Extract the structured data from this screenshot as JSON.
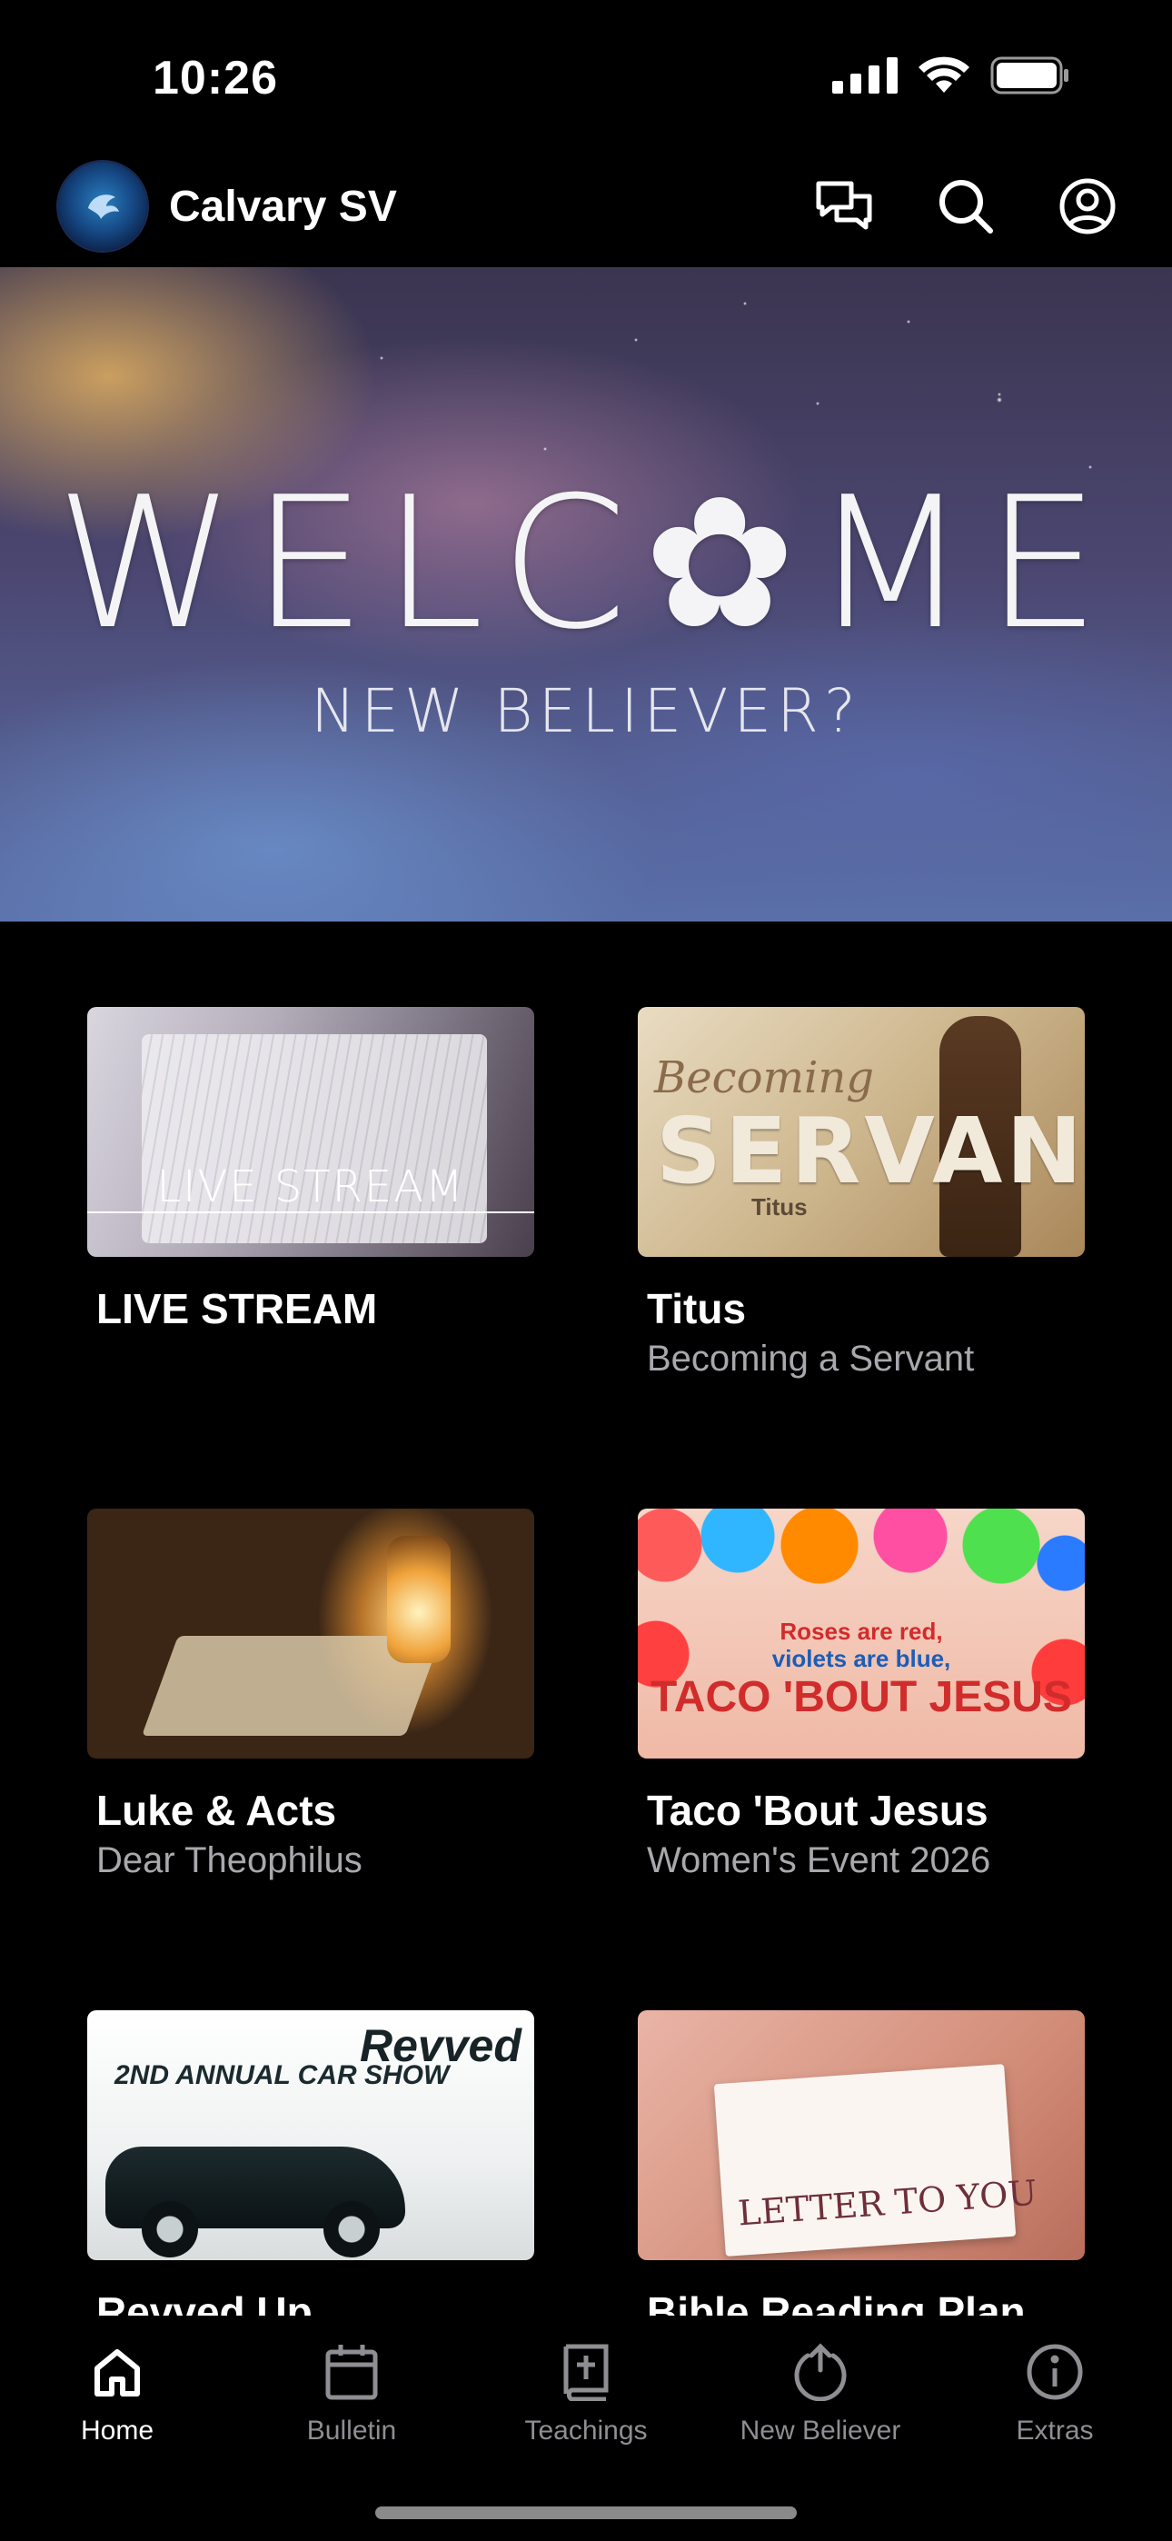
{
  "status_bar": {
    "time": "10:26"
  },
  "header": {
    "app_title": "Calvary SV",
    "actions": [
      "chat-icon",
      "search-icon",
      "account-icon"
    ]
  },
  "hero": {
    "title": "WELC✿ME",
    "subtitle": "NEW BELIEVER?"
  },
  "cards": [
    {
      "title": "LIVE STREAM",
      "subtitle": "",
      "thumb_text": "LIVE STREAM"
    },
    {
      "title": "Titus",
      "subtitle": "Becoming a Servant",
      "thumb_text": [
        "Becoming",
        "SERVANT",
        "Titus"
      ]
    },
    {
      "title": "Luke & Acts",
      "subtitle": "Dear Theophilus"
    },
    {
      "title": "Taco 'Bout Jesus",
      "subtitle": "Women's Event 2026",
      "thumb_text": [
        "Roses are red,",
        "violets are blue,",
        "TACO 'BOUT JESUS"
      ]
    },
    {
      "title": "Revved Up",
      "subtitle": "",
      "thumb_text": [
        "2ND ANNUAL CAR SHOW",
        "Revved"
      ]
    },
    {
      "title": "Bible Reading Plan",
      "subtitle": "",
      "thumb_text": "LETTER TO YOU"
    }
  ],
  "tabs": [
    {
      "label": "Home",
      "icon": "home-icon",
      "active": true
    },
    {
      "label": "Bulletin",
      "icon": "calendar-icon",
      "active": false
    },
    {
      "label": "Teachings",
      "icon": "bible-icon",
      "active": false
    },
    {
      "label": "New Believer",
      "icon": "power-up-icon",
      "active": false
    },
    {
      "label": "Extras",
      "icon": "info-icon",
      "active": false
    }
  ],
  "colors": {
    "background": "#000000",
    "text_primary": "#ffffff",
    "text_secondary": "#a8a8ad",
    "tab_inactive": "#8e8e93"
  }
}
